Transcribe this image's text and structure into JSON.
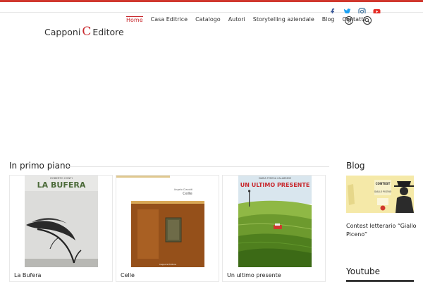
{
  "social": {
    "facebook_icon": "facebook-icon",
    "twitter_icon": "twitter-icon",
    "instagram_icon": "instagram-icon",
    "youtube_icon": "youtube-icon"
  },
  "logo": {
    "text_left": "Capponi",
    "mark": "C",
    "text_right": "Editore"
  },
  "nav": {
    "items": [
      "Home",
      "Casa Editrice",
      "Catalogo",
      "Autori",
      "Storytelling aziendale",
      "Blog",
      "Contatti"
    ],
    "cart_icon": "cart-icon",
    "search_icon": "search-icon"
  },
  "featured": {
    "title": "In primo piano",
    "books": [
      {
        "caption": "La Bufera",
        "author": "ROBERTO CONTI",
        "cover_title": "LA BUFERA"
      },
      {
        "caption": "Celle",
        "author": "Angelo Ciacotti",
        "cover_title": "Celle",
        "publisher": "Capponi Editore"
      },
      {
        "caption": "Un ultimo presente",
        "author": "MARIA TERESA CALABRESE",
        "cover_title": "UN ULTIMO PRESENTE"
      }
    ]
  },
  "sidebar": {
    "blog_title": "Blog",
    "blog_post": {
      "caption": "Contest letterario “Giallo Piceno”",
      "thumb_line1": "CONTEST",
      "thumb_line2": "GIALLO PICENO"
    },
    "youtube_title": "Youtube"
  },
  "colors": {
    "accent": "#c8282d",
    "facebook": "#3b5998",
    "twitter": "#1da1f2",
    "instagram": "#3f729b",
    "youtube": "#e52d27"
  }
}
